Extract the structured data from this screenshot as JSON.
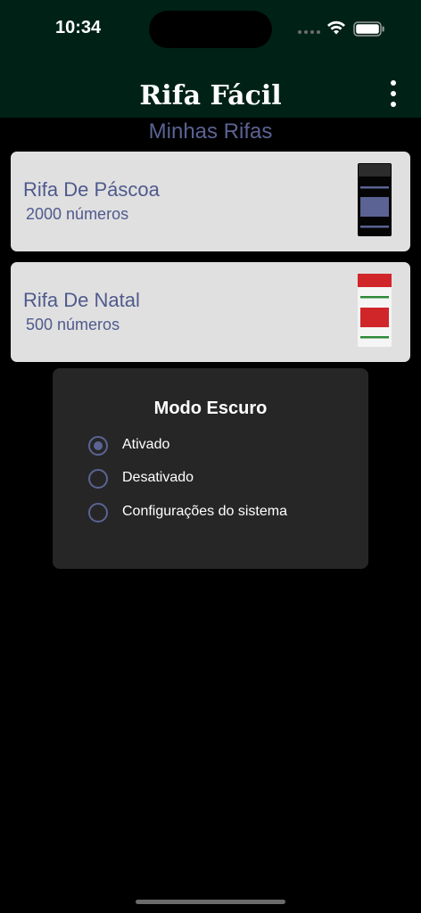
{
  "status": {
    "time": "10:34",
    "signal_icon": "signal-dots-icon",
    "wifi_icon": "wifi-icon",
    "battery_icon": "battery-icon"
  },
  "header": {
    "title": "Rifa Fácil",
    "menu_icon": "more-vertical-icon",
    "background": "#002216"
  },
  "section": {
    "title": "Minhas Rifas"
  },
  "raffles": [
    {
      "title": "Rifa De Páscoa",
      "subtitle": "2000 números",
      "thumb_colors": [
        "#1e1e1e",
        "#5b6394"
      ]
    },
    {
      "title": "Rifa De Natal",
      "subtitle": "500 números",
      "thumb_colors": [
        "#d0262a",
        "#2d8a38"
      ]
    }
  ],
  "dark_mode_dialog": {
    "title": "Modo Escuro",
    "options": [
      {
        "label": "Ativado",
        "selected": true
      },
      {
        "label": "Desativado",
        "selected": false
      },
      {
        "label": "Configurações do sistema",
        "selected": false
      }
    ]
  },
  "colors": {
    "accent": "#5b6394",
    "card_bg": "#e0e0e0",
    "dialog_bg": "#262626"
  }
}
